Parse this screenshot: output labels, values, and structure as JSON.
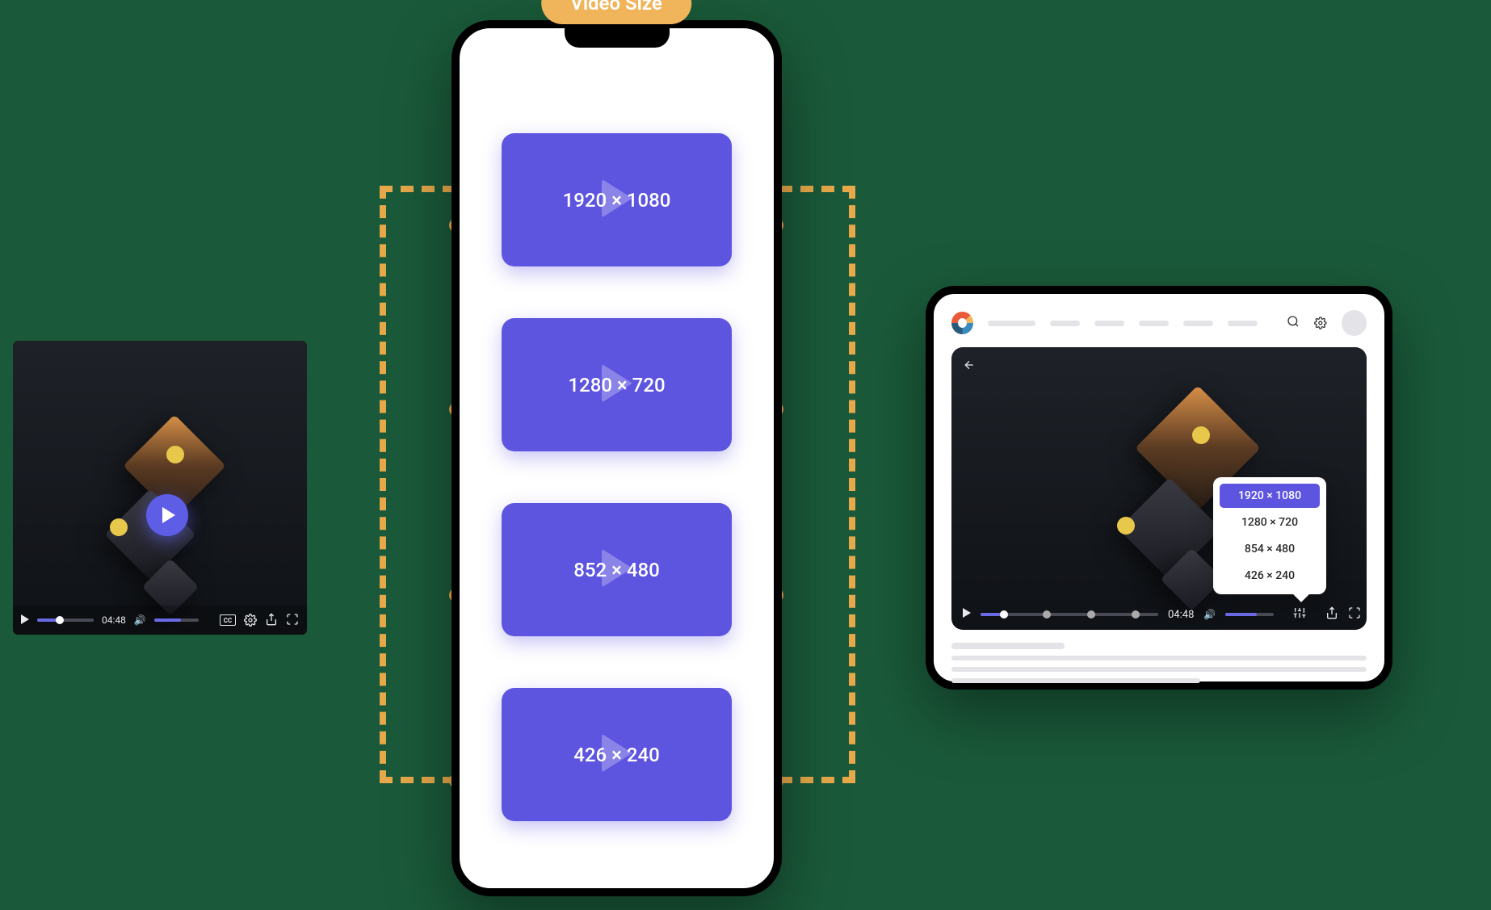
{
  "badge": {
    "label": "Video Size"
  },
  "resolutions": {
    "r0": "1920 × 1080",
    "r1": "1280 × 720",
    "r2": "852 × 480",
    "r3": "426 × 240"
  },
  "left_player": {
    "time": "04:48",
    "cc_label": "CC"
  },
  "tablet_player": {
    "time": "04:48",
    "menu": {
      "m0": "1920 × 1080",
      "m1": "1280 × 720",
      "m2": "854 × 480",
      "m3": "426 × 240"
    }
  }
}
